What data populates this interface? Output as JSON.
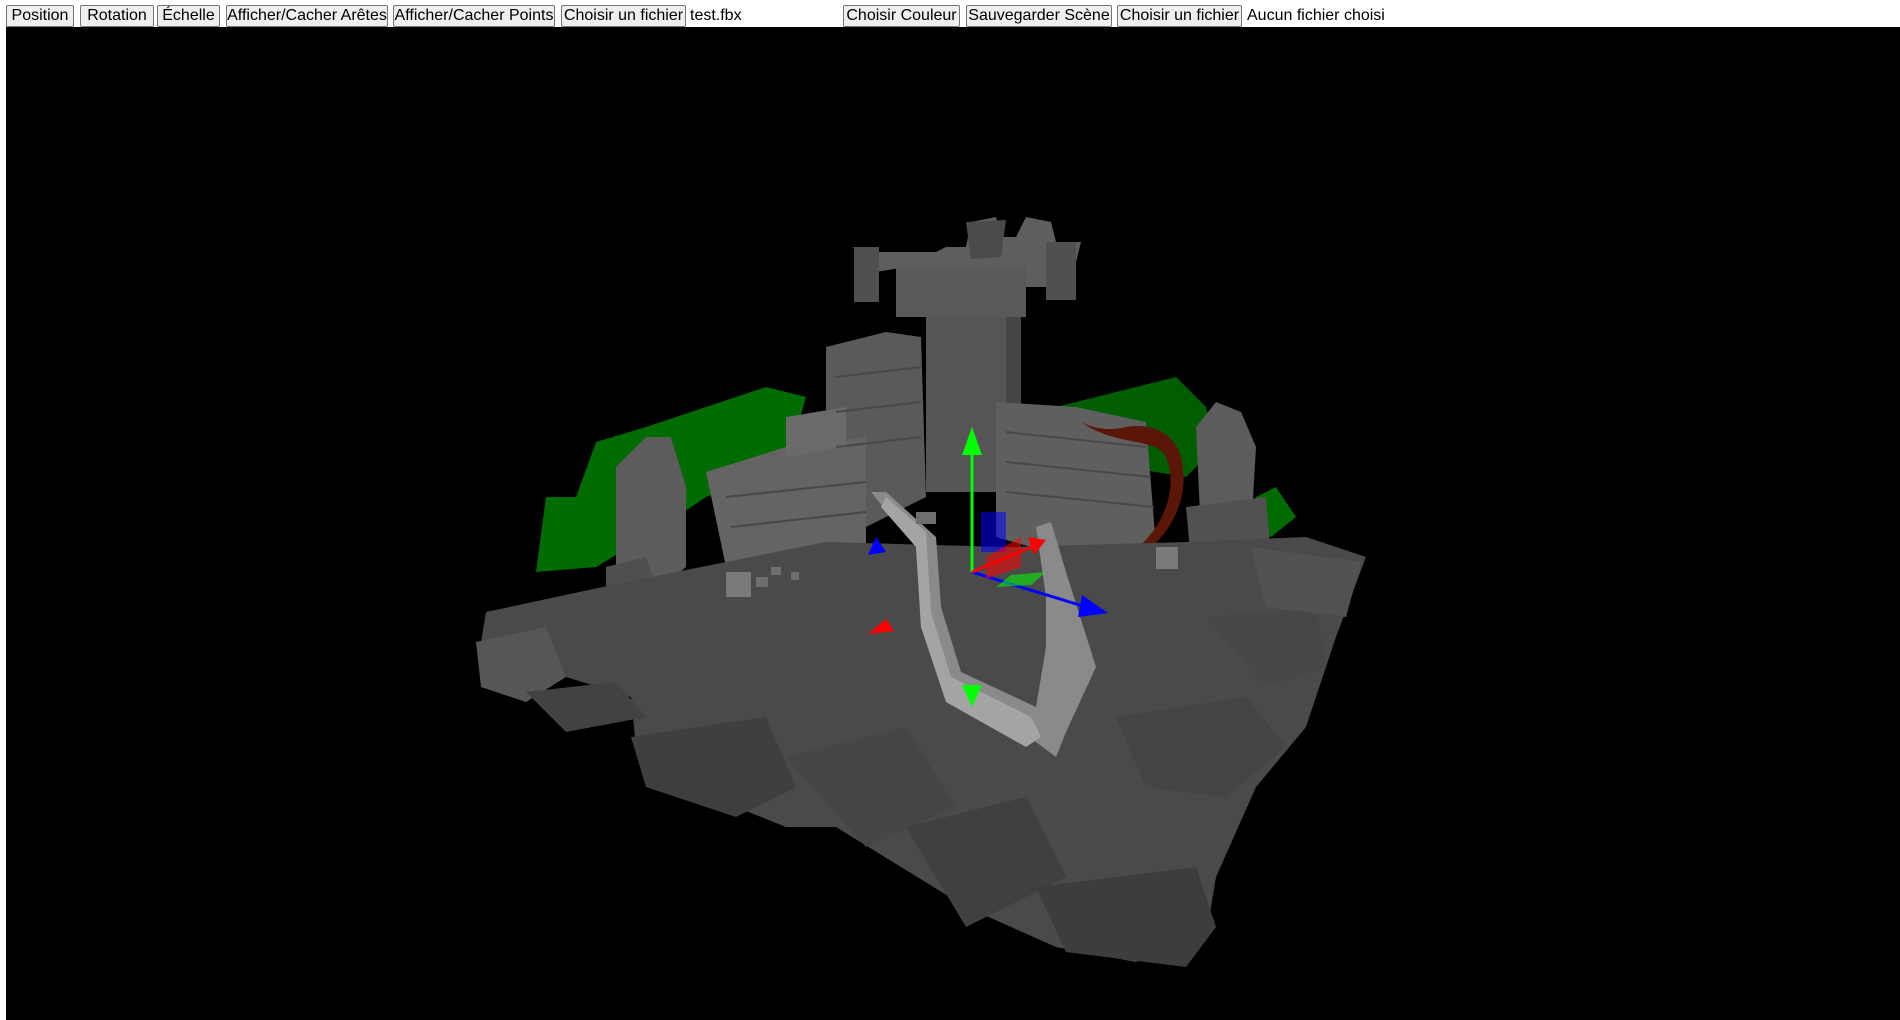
{
  "toolbar": {
    "position_label": "Position",
    "rotation_label": "Rotation",
    "scale_label": "Échelle",
    "toggle_edges_label": "Afficher/Cacher Arêtes",
    "toggle_points_label": "Afficher/Cacher Points",
    "choose_file_1_label": "Choisir un fichier",
    "file_1_name": "test.fbx",
    "choose_color_label": "Choisir Couleur",
    "save_scene_label": "Sauvegarder Scène",
    "choose_file_2_label": "Choisir un fichier",
    "file_2_name": "Aucun fichier choisi"
  },
  "viewport": {
    "background_color": "#000000",
    "scene_model": "ruined-castle",
    "gizmo_mode": "translate",
    "axis_colors": {
      "x": "#ff0000",
      "y": "#00ff00",
      "z": "#0000ff"
    }
  }
}
